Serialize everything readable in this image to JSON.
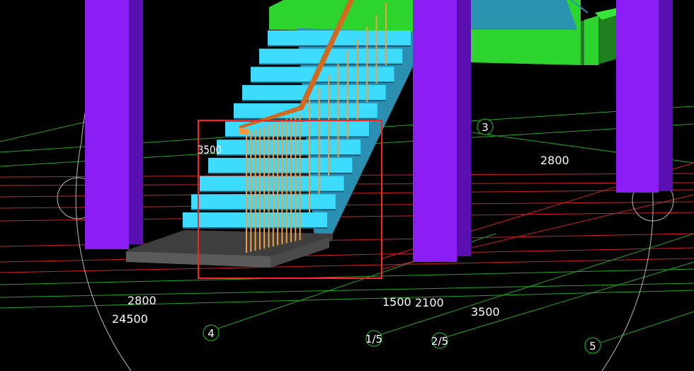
{
  "colors": {
    "background": "#000000",
    "grid_green": "#1fa81f",
    "grid_red": "#d42020",
    "column_face": "#8a1ef5",
    "column_side": "#5a10b0",
    "step_top": "#3ddcff",
    "step_side": "#2a8fb0",
    "slab_green": "#2ed42e",
    "slab_teal": "#2a93ad",
    "rail": "#e07a2a",
    "baluster": "#f0a040",
    "landing": "#444444",
    "selection_box": "#ff2020",
    "orbit_circle": "#bbbbbb"
  },
  "dimensions": [
    {
      "text": "2800",
      "id": "dim-2800-right"
    },
    {
      "text": "2800",
      "id": "dim-2800-left"
    },
    {
      "text": "24500",
      "id": "dim-24500"
    },
    {
      "text": "1500",
      "id": "dim-1500"
    },
    {
      "text": "2100",
      "id": "dim-2100"
    },
    {
      "text": "3500",
      "id": "dim-3500-right"
    },
    {
      "text": "3500",
      "id": "dim-3500-partial"
    }
  ],
  "axis_markers": [
    {
      "label": "3"
    },
    {
      "label": "4"
    },
    {
      "label": "1/5"
    },
    {
      "label": "2/5"
    },
    {
      "label": "5"
    }
  ]
}
